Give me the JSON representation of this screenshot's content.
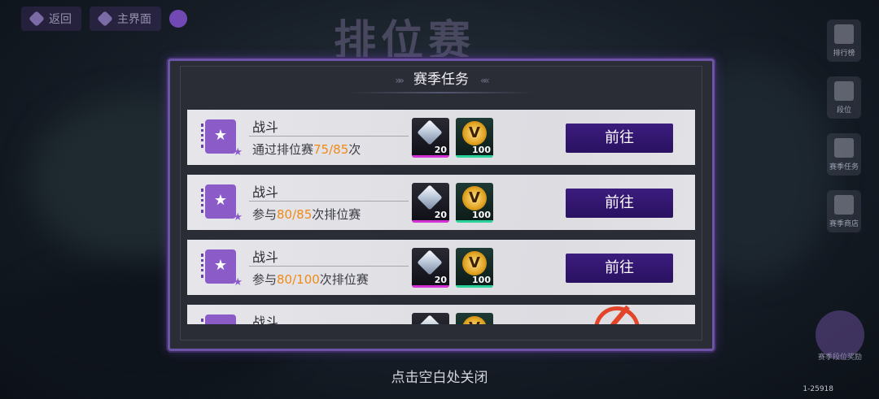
{
  "topbar": {
    "back_label": "返回",
    "main_label": "主界面"
  },
  "background_title": "排位赛",
  "side_menu": [
    {
      "icon": "ranking-icon",
      "label": "排行榜"
    },
    {
      "icon": "shield-icon",
      "label": "段位"
    },
    {
      "icon": "card-icon",
      "label": "赛季任务"
    },
    {
      "icon": "cart-icon",
      "label": "赛季商店"
    }
  ],
  "side_badge_label": "赛季段位奖励",
  "modal": {
    "title": "赛季任务",
    "tasks": [
      {
        "name": "战斗",
        "desc_prefix": "通过排位赛",
        "progress": "75/85",
        "desc_suffix": "次",
        "reward_diamond": "20",
        "reward_medal": "100",
        "action": "前往"
      },
      {
        "name": "战斗",
        "desc_prefix": "参与",
        "progress": "80/85",
        "desc_suffix": "次排位赛",
        "reward_diamond": "20",
        "reward_medal": "100",
        "action": "前往"
      },
      {
        "name": "战斗",
        "desc_prefix": "参与",
        "progress": "80/100",
        "desc_suffix": "次排位赛",
        "reward_diamond": "20",
        "reward_medal": "100",
        "action": "前往"
      },
      {
        "name": "战斗",
        "desc_prefix": "",
        "progress": "",
        "desc_suffix": "",
        "reward_diamond": "",
        "reward_medal": "",
        "action": ""
      }
    ]
  },
  "close_hint": "点击空白处关闭",
  "version": "1-25918",
  "colors": {
    "accent": "#3b1d7e",
    "highlight": "#f08a18",
    "frame": "#6d55a6"
  }
}
